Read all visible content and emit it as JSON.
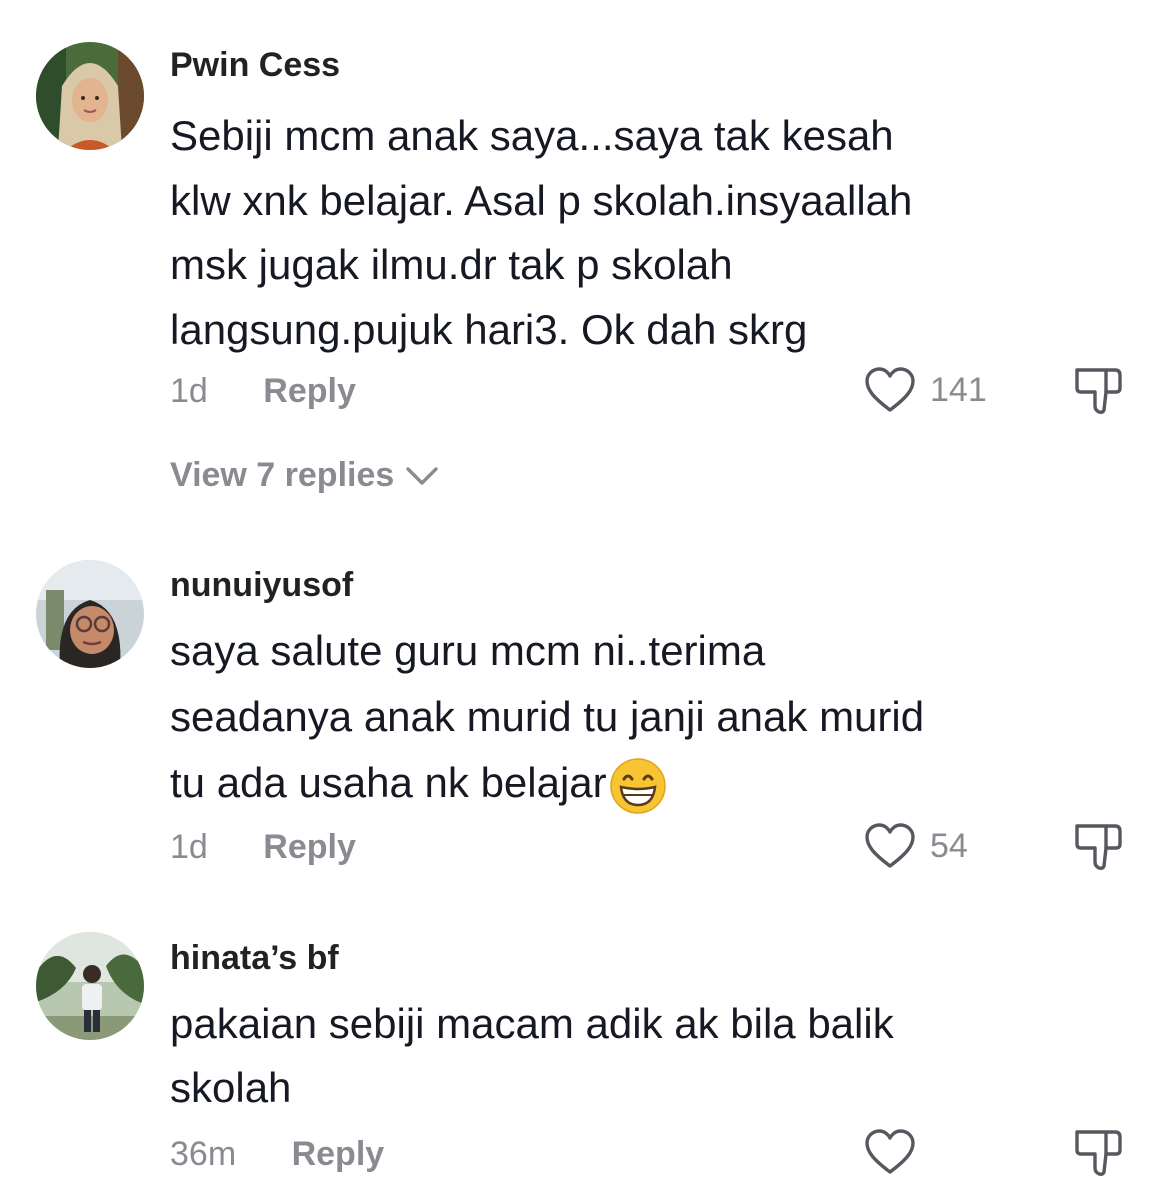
{
  "ui": {
    "reply_label": "Reply",
    "colors": {
      "text": "#161823",
      "secondary": "#8a8b91",
      "background": "#ffffff"
    }
  },
  "comments": [
    {
      "username": "Pwin Cess",
      "lines": [
        "Sebiji mcm anak saya...saya tak kesah",
        "klw xnk belajar. Asal p skolah.insyaallah",
        "msk jugak ilmu.dr tak p skolah",
        "langsung.pujuk hari3. Ok dah skrg"
      ],
      "time": "1d",
      "likes": "141",
      "view_replies": "View 7 replies",
      "avatar_icon": "avatar-woman-hijab"
    },
    {
      "username": "nunuiyusof",
      "lines": [
        "saya salute guru mcm ni..terima",
        "seadanya anak murid tu janji anak murid",
        "tu ada usaha nk belajar"
      ],
      "emoji": "grinning-face-with-smiling-eyes",
      "time": "1d",
      "likes": "54",
      "avatar_icon": "avatar-woman-glasses"
    },
    {
      "username": "hinata’s bf",
      "lines": [
        "pakaian sebiji macam adik ak bila balik",
        "skolah"
      ],
      "time": "36m",
      "likes": "",
      "avatar_icon": "avatar-man-outdoor"
    }
  ]
}
